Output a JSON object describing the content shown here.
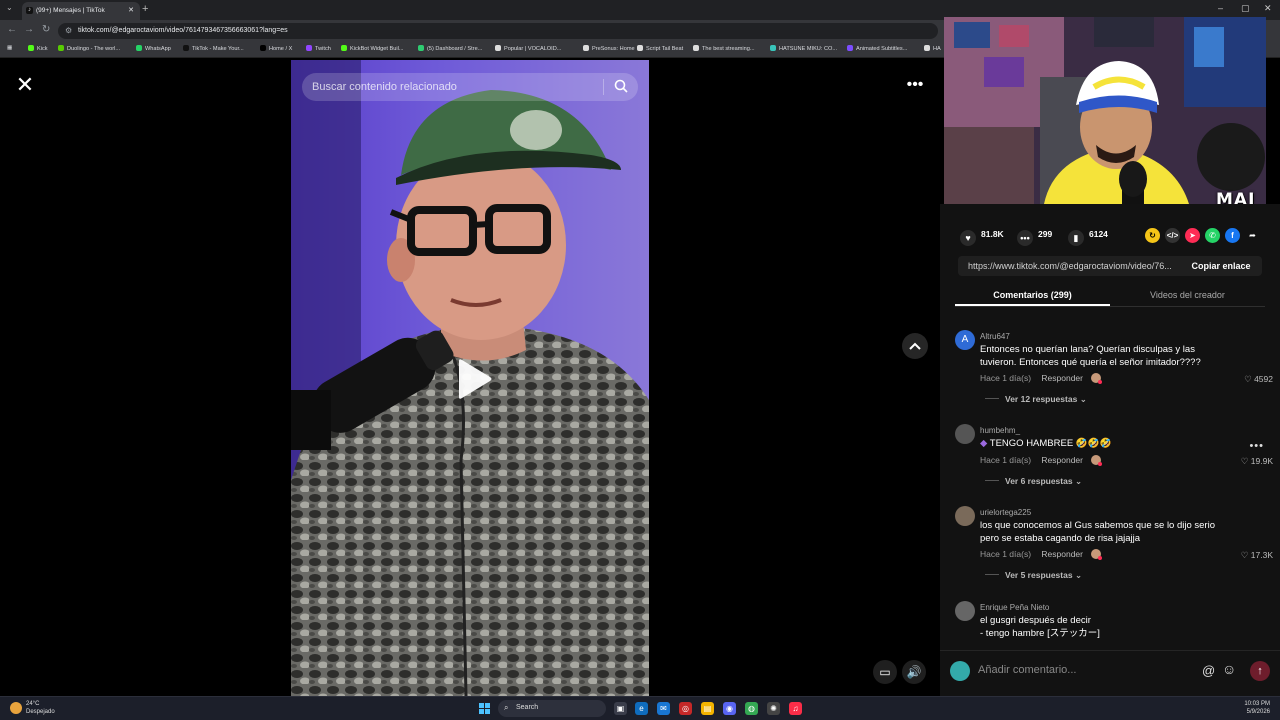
{
  "browser": {
    "tab_title": "(99+) Mensajes | TikTok",
    "url": "tiktok.com/@edgaroctaviom/video/7614793467356663061?lang=es",
    "bookmarks": [
      {
        "label": "Kick",
        "color": "#53fc18"
      },
      {
        "label": "Duolingo - The worl...",
        "color": "#58cc02"
      },
      {
        "label": "WhatsApp",
        "color": "#25d366"
      },
      {
        "label": "TikTok - Make Your...",
        "color": "#111111"
      },
      {
        "label": "Home / X",
        "color": "#000000"
      },
      {
        "label": "Twitch",
        "color": "#9146ff"
      },
      {
        "label": "KickBot Widget Buil...",
        "color": "#53fc18"
      },
      {
        "label": "(5) Dashboard / Stre...",
        "color": "#2ecc71"
      },
      {
        "label": "Popular | VOCALOID...",
        "color": "#dddddd"
      },
      {
        "label": "PreSonus: Home",
        "color": "#dddddd"
      },
      {
        "label": "Script Tail Beat",
        "color": "#dddddd"
      },
      {
        "label": "The best streaming...",
        "color": "#dddddd"
      },
      {
        "label": "HATSUNE MIKU: CO...",
        "color": "#39c5bb"
      },
      {
        "label": "Animated Subtitles...",
        "color": "#7c4dff"
      },
      {
        "label": "HA",
        "color": "#dddddd"
      }
    ]
  },
  "video": {
    "search_placeholder": "Buscar contenido relacionado"
  },
  "webcam": {
    "name": "MAI"
  },
  "stats": {
    "likes": "81.8K",
    "comments": "299",
    "saves": "6124"
  },
  "share": {
    "link": "https://www.tiktok.com/@edgaroctaviom/video/76...",
    "copy_label": "Copiar enlace"
  },
  "tabs": {
    "comments": "Comentarios (299)",
    "creator": "Videos del creador"
  },
  "comments": [
    {
      "user": "Altru647",
      "avatar": "A",
      "text": "Entonces no querían lana? Querían disculpas y las tuvieron. Entonces qué quería el señor imitador????",
      "time": "Hace 1 día(s)",
      "reply": "Responder",
      "likes": "4592",
      "replies": "Ver 12 respuestas"
    },
    {
      "user": "humbehm_",
      "avatar": "",
      "text": "TENGO HAMBREE 🤣🤣🤣",
      "time": "Hace 1 día(s)",
      "reply": "Responder",
      "likes": "19.9K",
      "replies": "Ver 6 respuestas"
    },
    {
      "user": "urielortega225",
      "avatar": "",
      "text": "los que conocemos al Gus sabemos que se lo dijo serio pero se estaba cagando de risa jajajja",
      "time": "Hace 1 día(s)",
      "reply": "Responder",
      "likes": "17.3K",
      "replies": "Ver 5 respuestas"
    },
    {
      "user": "Enrique Peña Nieto",
      "avatar": "",
      "text": "el gusgri después de decir\n- tengo hambre [ステッカー]",
      "time": "Hace 1 día(s)",
      "reply": "Responder",
      "likes": "",
      "replies": ""
    }
  ],
  "composer": {
    "placeholder": "Añadir comentario..."
  },
  "taskbar": {
    "temp": "24°C",
    "weather": "Despejado",
    "search": "Search",
    "time": "10:03 PM",
    "date": "5/9/2026"
  }
}
